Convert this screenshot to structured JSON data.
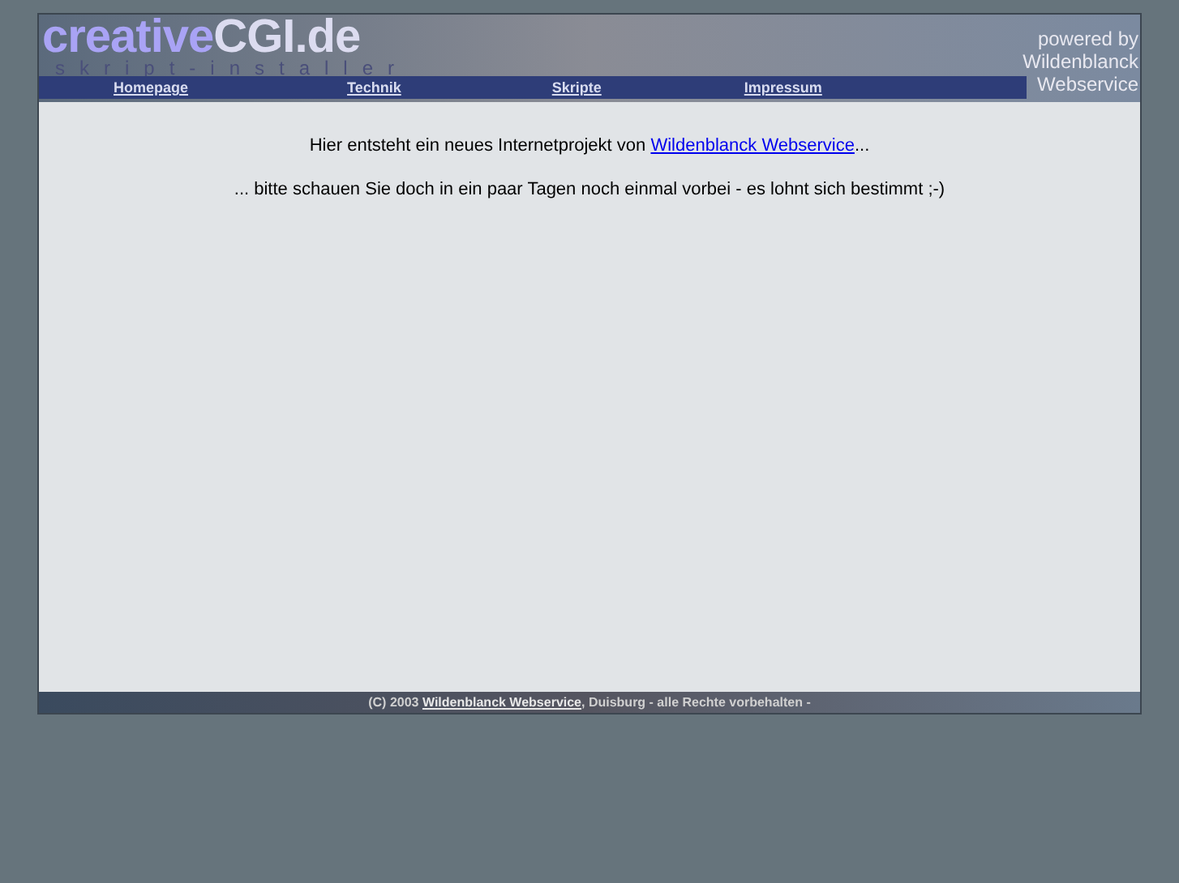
{
  "header": {
    "logo_main": "creative",
    "logo_accent": "CGI.de",
    "logo_sub": "skript-installer",
    "powered_by": [
      "powered by",
      "Wildenblanck",
      "Webservice"
    ]
  },
  "nav": [
    {
      "label": "Homepage"
    },
    {
      "label": "Technik"
    },
    {
      "label": "Skripte"
    },
    {
      "label": "Impressum"
    }
  ],
  "content": {
    "intro_before": "Hier entsteht ein neues Internetprojekt von ",
    "intro_link": "Wildenblanck Webservice",
    "intro_after": "...",
    "note": "... bitte schauen Sie doch in ein paar Tagen noch einmal vorbei - es lohnt sich bestimmt ;-)"
  },
  "footer": {
    "before": "(C) 2003 ",
    "link": "Wildenblanck Webservice",
    "after": ", Duisburg - alle Rechte vorbehalten -"
  }
}
